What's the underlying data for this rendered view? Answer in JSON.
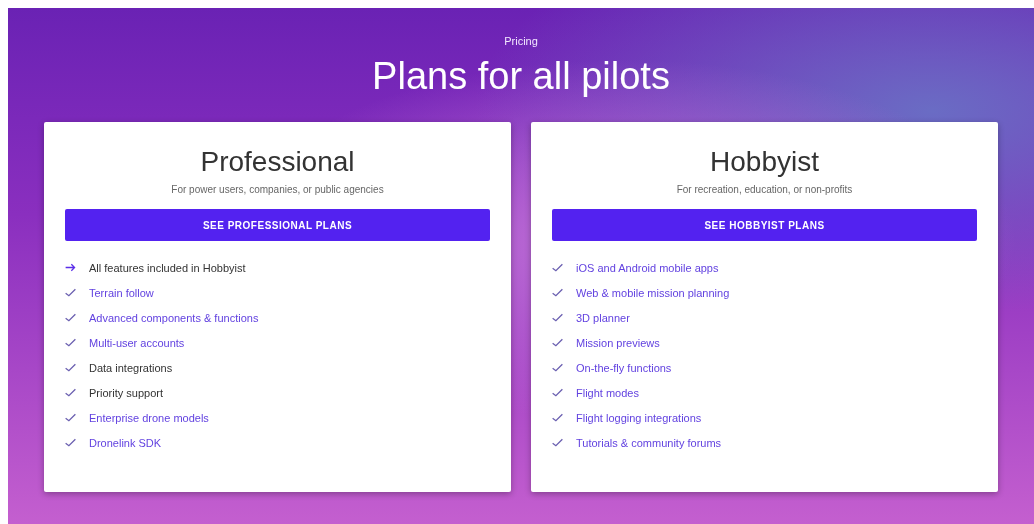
{
  "header": {
    "eyebrow": "Pricing",
    "title": "Plans for all pilots"
  },
  "plans": [
    {
      "name": "Professional",
      "subtitle": "For power users, companies, or public agencies",
      "button": "SEE PROFESSIONAL PLANS",
      "features": [
        {
          "text": "All features included in Hobbyist",
          "kind": "arrow",
          "link": false
        },
        {
          "text": "Terrain follow",
          "kind": "check",
          "link": true
        },
        {
          "text": "Advanced components & functions",
          "kind": "check",
          "link": true
        },
        {
          "text": "Multi-user accounts",
          "kind": "check",
          "link": true
        },
        {
          "text": "Data integrations",
          "kind": "check",
          "link": false
        },
        {
          "text": "Priority support",
          "kind": "check",
          "link": false
        },
        {
          "text": "Enterprise drone models",
          "kind": "check",
          "link": true
        },
        {
          "text": "Dronelink SDK",
          "kind": "check",
          "link": true
        }
      ]
    },
    {
      "name": "Hobbyist",
      "subtitle": "For recreation, education, or non-profits",
      "button": "SEE HOBBYIST PLANS",
      "features": [
        {
          "text": "iOS and Android mobile apps",
          "kind": "check",
          "link": true
        },
        {
          "text": "Web & mobile mission planning",
          "kind": "check",
          "link": true
        },
        {
          "text": "3D planner",
          "kind": "check",
          "link": true
        },
        {
          "text": "Mission previews",
          "kind": "check",
          "link": true
        },
        {
          "text": "On-the-fly functions",
          "kind": "check",
          "link": true
        },
        {
          "text": "Flight modes",
          "kind": "check",
          "link": true
        },
        {
          "text": "Flight logging integrations",
          "kind": "check",
          "link": true
        },
        {
          "text": "Tutorials & community forums",
          "kind": "check",
          "link": true
        }
      ]
    }
  ]
}
